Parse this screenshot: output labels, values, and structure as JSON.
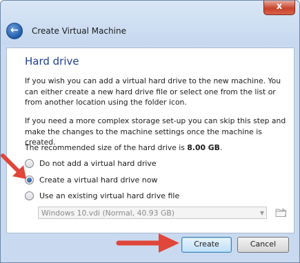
{
  "window": {
    "title": "Create Virtual Machine",
    "close_glyph": "x",
    "back_glyph": "←"
  },
  "section": {
    "title": "Hard drive",
    "paragraph1": "If you wish you can add a virtual hard drive to the new machine. You can either create a new hard drive file or select one from the list or from another location using the folder icon.",
    "paragraph2": "If you need a more complex storage set-up you can skip this step and make the changes to the machine settings once the machine is created.",
    "recommended_prefix": "The recommended size of the hard drive is ",
    "recommended_size": "8.00 GB",
    "recommended_suffix": "."
  },
  "options": [
    {
      "label": "Do not add a virtual hard drive",
      "selected": false
    },
    {
      "label": "Create a virtual hard drive now",
      "selected": true
    },
    {
      "label": "Use an existing virtual hard drive file",
      "selected": false
    }
  ],
  "disk_select": {
    "value": "Windows 10.vdi (Normal, 40.93 GB)",
    "enabled": false
  },
  "buttons": {
    "create": "Create",
    "cancel": "Cancel"
  },
  "icons": {
    "folder": "folder-icon",
    "back": "back-arrow-icon"
  },
  "colors": {
    "annotation_arrow": "#e0463a",
    "section_title": "#1e3d8f",
    "window_frame": "#c9daf0"
  }
}
